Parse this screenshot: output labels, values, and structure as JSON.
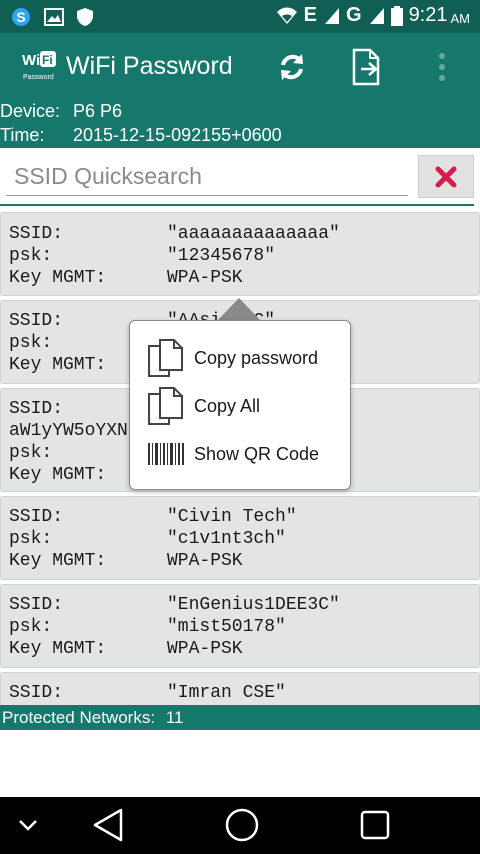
{
  "status_bar": {
    "network": "E",
    "network2": "G",
    "time": "9:21",
    "ampm": "AM",
    "icons": [
      "skype-icon",
      "image-icon",
      "shield-icon",
      "wifi-signal-icon",
      "cell-signal-icon",
      "battery-icon"
    ]
  },
  "app_bar": {
    "title": "WiFi Password",
    "logo_text": "Wi",
    "logo_badge": "Fi",
    "logo_sub": "Password",
    "actions": [
      "refresh-icon",
      "export-icon",
      "overflow-menu-icon"
    ]
  },
  "device_info": {
    "device_label": "Device:",
    "device_value": "P6 P6",
    "time_label": "Time:",
    "time_value": "2015-12-15-092155+0600"
  },
  "search": {
    "placeholder": "SSID Quicksearch",
    "value": ""
  },
  "labels": {
    "ssid": "SSID:",
    "psk": "psk:",
    "key_mgmt": "Key MGMT:"
  },
  "networks": [
    {
      "ssid": "\"aaaaaaaaaaaaaa\"",
      "psk": "\"12345678\"",
      "key_mgmt": "WPA-PSK"
    },
    {
      "ssid": "\"AAsi...C\"",
      "psk": "",
      "key_mgmt": ""
    },
    {
      "ssid": "aW1yYW5oYXN",
      "psk": "",
      "key_mgmt": ""
    },
    {
      "ssid": "\"Civin Tech\"",
      "psk": "\"c1v1nt3ch\"",
      "key_mgmt": "WPA-PSK"
    },
    {
      "ssid": "\"EnGenius1DEE3C\"",
      "psk": "\"mist50178\"",
      "key_mgmt": "WPA-PSK"
    },
    {
      "ssid": "\"Imran CSE\"",
      "psk": "",
      "key_mgmt": ""
    }
  ],
  "popup_menu": {
    "items": [
      {
        "label": "Copy password",
        "icon": "copy-icon"
      },
      {
        "label": "Copy All",
        "icon": "copy-icon"
      },
      {
        "label": "Show QR Code",
        "icon": "barcode-icon"
      }
    ]
  },
  "footer": {
    "label": "Protected Networks:",
    "count": "11"
  },
  "nav_bar": {
    "buttons": [
      "collapse-icon",
      "back-icon",
      "home-icon",
      "recents-icon"
    ]
  },
  "colors": {
    "primary": "#16786d",
    "status_bar": "#0f5f55",
    "card": "#e3e5e4",
    "clear_icon": "#d81b4a"
  }
}
